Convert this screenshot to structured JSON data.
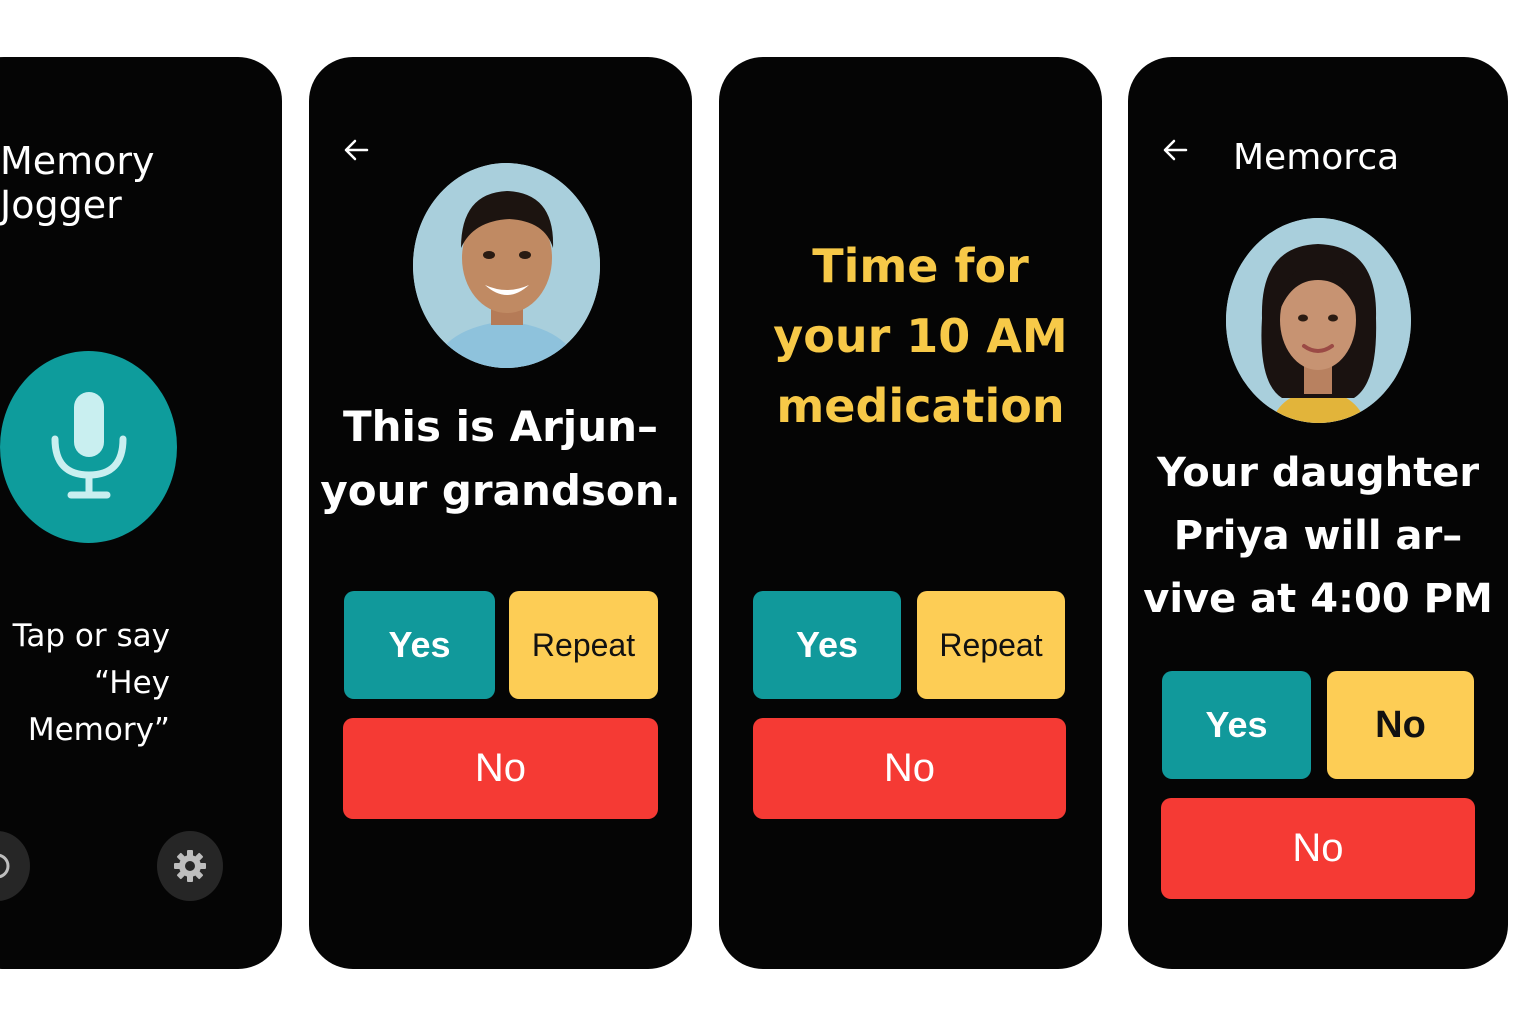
{
  "colors": {
    "background": "#ffffff",
    "screen": "#050505",
    "teal": "#11999b",
    "yellow": "#fdcd55",
    "red": "#f53a34",
    "reminder_text": "#f7c948"
  },
  "screen1": {
    "title": "Memory\nJogger",
    "mic_icon": "microphone-icon",
    "hint": "Tap or say\n“Hey Memory”",
    "left_icon": "help-icon",
    "settings_icon": "gear-icon"
  },
  "screen2": {
    "back_icon": "back-arrow-icon",
    "message": "This is Arjun–\nyour grandson.",
    "yes": "Yes",
    "repeat": "Repeat",
    "no": "No"
  },
  "screen3": {
    "message": "Time for\nyour 10 AM\nmedication",
    "yes": "Yes",
    "repeat": "Repeat",
    "no": "No"
  },
  "screen4": {
    "back_icon": "back-arrow-icon",
    "header_title": "Memorca",
    "message": "Your daughter\nPriya will ar–\nvive at 4:00 PM",
    "yes": "Yes",
    "no_secondary": "No",
    "no": "No"
  }
}
